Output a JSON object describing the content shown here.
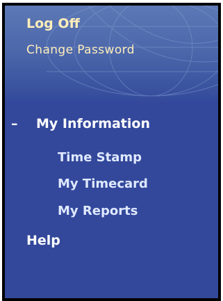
{
  "nav": {
    "log_off": "Log Off",
    "change_password": "Change Password",
    "section": {
      "toggle": "–",
      "label": "My Information",
      "items": [
        {
          "label": "Time Stamp"
        },
        {
          "label": "My Timecard"
        },
        {
          "label": "My Reports"
        }
      ]
    },
    "help": "Help"
  },
  "colors": {
    "panel": "#33489b",
    "header_art": "#5d78b5",
    "link_top": "#ffeebb",
    "link_sub": "#dfe9ff",
    "link_main": "#ffffff",
    "frame": "#000000"
  }
}
